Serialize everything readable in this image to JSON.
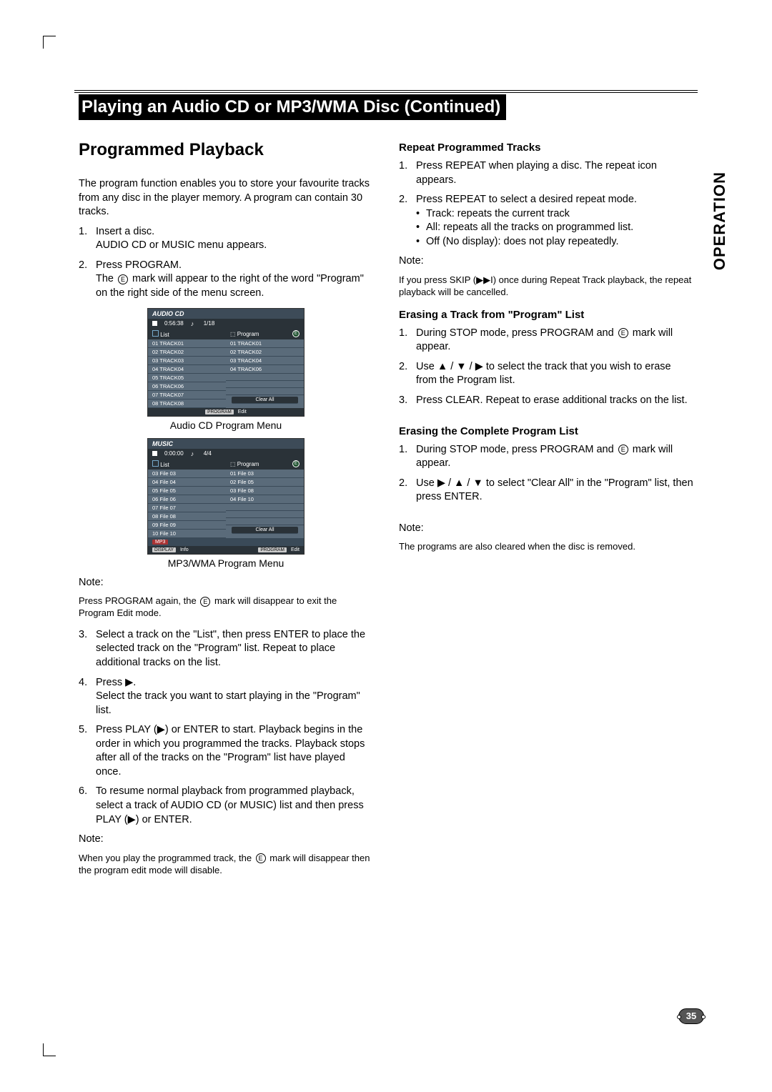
{
  "side_tab": "OPERATION",
  "page_number": "35",
  "title": "Playing an Audio CD or MP3/WMA Disc (Continued)",
  "section_heading": "Programmed Playback",
  "left": {
    "intro": "The program function enables you to store your favourite tracks from any disc in the player memory. A program can contain 30 tracks.",
    "step1a": "Insert a disc.",
    "step1b": "AUDIO CD or MUSIC menu appears.",
    "step2a": "Press PROGRAM.",
    "step2b_pre": "The ",
    "step2b_post": " mark will appear to the right of the word \"Program\" on the right side of the menu screen.",
    "menu1_caption": "Audio CD Program Menu",
    "menu2_caption": "MP3/WMA Program Menu",
    "note1_label": "Note:",
    "note1_pre": "Press PROGRAM again, the ",
    "note1_post": " mark will disappear to exit the Program Edit mode.",
    "step3": "Select a track on the \"List\", then press ENTER to place the selected track on the \"Program\" list. Repeat to place additional tracks on the list.",
    "step4a": "Press ▶.",
    "step4b": "Select the track you want to start playing in the \"Program\" list.",
    "step5": "Press PLAY (▶) or ENTER to start. Playback begins in the order in which you programmed the tracks. Playback stops after all of the tracks on the \"Program\" list have played once.",
    "step6": "To resume normal playback from programmed playback, select a track of AUDIO CD (or MUSIC) list and then press PLAY (▶) or ENTER.",
    "note2_label": "Note:",
    "note2_pre": "When you play the programmed track, the ",
    "note2_post": " mark will disappear then the program edit mode will disable."
  },
  "right": {
    "h1": "Repeat Programmed Tracks",
    "r1": "Press REPEAT when playing a disc. The repeat icon appears.",
    "r2": "Press REPEAT to select a desired repeat mode.",
    "r2a": "Track: repeats the current track",
    "r2b": "All: repeats all the tracks on programmed list.",
    "r2c": "Off (No display): does not play repeatedly.",
    "r_note_label": "Note:",
    "r_note": "If you press SKIP (▶▶I) once during Repeat Track playback, the repeat playback will be cancelled.",
    "h2": "Erasing a Track from \"Program\" List",
    "e1_pre": "During STOP mode, press PROGRAM and ",
    "e1_post": " mark will appear.",
    "e2": "Use ▲ / ▼ / ▶ to select the track that you wish to erase from the Program list.",
    "e3": "Press CLEAR. Repeat to erase additional tracks on the list.",
    "h3": "Erasing the Complete Program List",
    "c1_pre": "During STOP mode, press PROGRAM and ",
    "c1_post": " mark will appear.",
    "c2": "Use ▶ / ▲ / ▼ to select \"Clear All\" in the \"Program\" list, then press ENTER.",
    "c_note_label": "Note:",
    "c_note": "The programs are also cleared when the disc is removed."
  },
  "menu1": {
    "type": "AUDIO CD",
    "time": "0:56:38",
    "count": "1/18",
    "list_label": "List",
    "prog_label": "Program",
    "left_rows": [
      "01 TRACK01",
      "02 TRACK02",
      "03 TRACK03",
      "04 TRACK04",
      "05 TRACK05",
      "06 TRACK06",
      "07 TRACK07",
      "08 TRACK08"
    ],
    "right_rows": [
      "01 TRACK01",
      "02 TRACK02",
      "03 TRACK04",
      "04 TRACK06"
    ],
    "clear": "Clear All",
    "foot": "Edit",
    "foot_badge": "PROGRAM"
  },
  "menu2": {
    "type": "MUSIC",
    "time": "0:00:00",
    "count": "4/4",
    "list_label": "List",
    "prog_label": "Program",
    "left_rows": [
      "03 File 03",
      "04 File 04",
      "05 File 05",
      "06 File 06",
      "07 File 07",
      "08 File 08",
      "09 File 09",
      "10 File 10"
    ],
    "right_rows": [
      "01 File 03",
      "02 File 05",
      "03 File 08",
      "04 File 10"
    ],
    "clear": "Clear All",
    "badge": "MP3",
    "foot_left_badge": "DISPLAY",
    "foot_left": "Info",
    "foot_badge": "PROGRAM",
    "foot": "Edit"
  }
}
